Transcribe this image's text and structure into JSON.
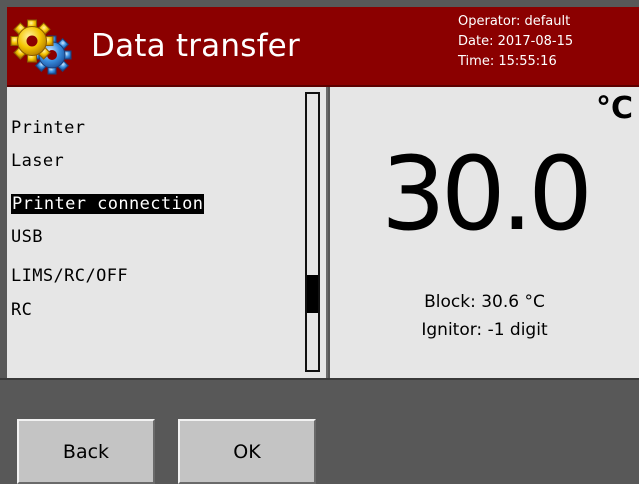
{
  "header": {
    "title": "Data transfer",
    "logo_icon": "gears-icon",
    "operator": "Operator: default",
    "date": "Date: 2017-08-15",
    "time": "Time: 15:55:16",
    "background_color": "#8b0000"
  },
  "menu": {
    "items": [
      {
        "label": "Printer",
        "value": "Laser"
      },
      {
        "label": "Printer connection",
        "value": "USB",
        "selected": true
      },
      {
        "label": "LIMS/RC/OFF",
        "value": "RC"
      }
    ],
    "scroll_position": 0.67
  },
  "reading": {
    "unit": "°C",
    "temperature": "30.0",
    "block": "Block: 30.6 °C",
    "ignitor": "Ignitor: -1 digit"
  },
  "buttons": {
    "back": "Back",
    "ok": "OK"
  }
}
